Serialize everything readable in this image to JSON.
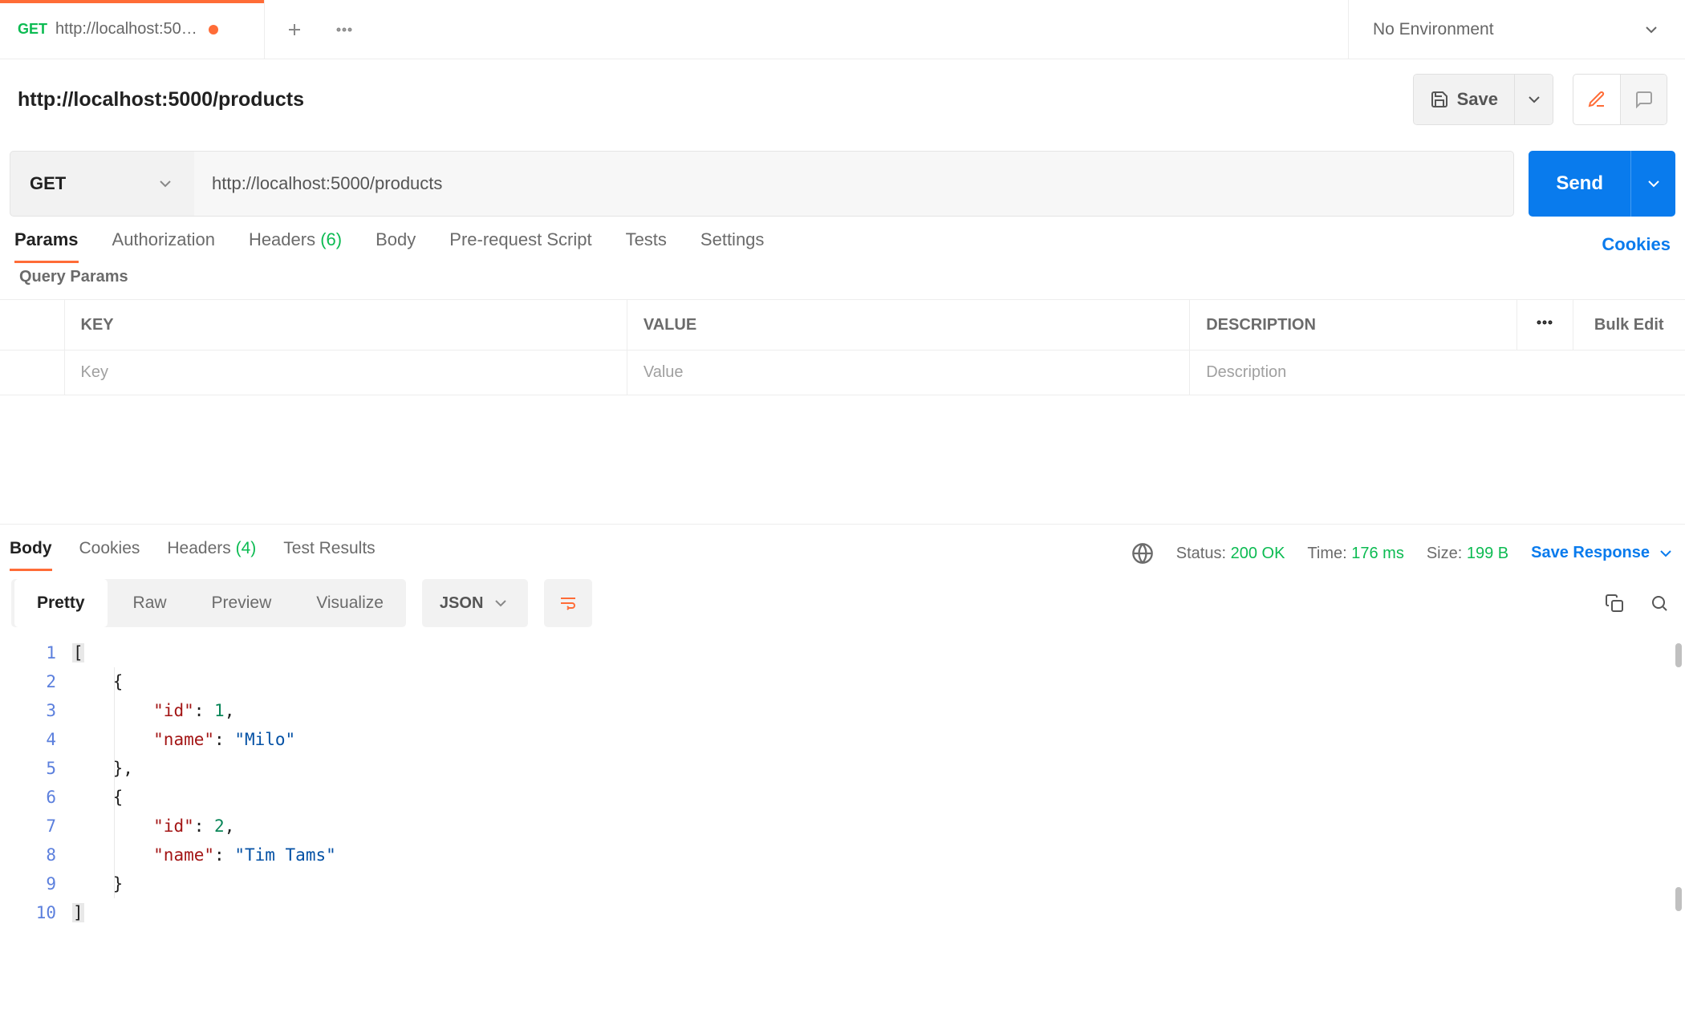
{
  "colors": {
    "accent": "#ff6c37",
    "primary": "#097bed",
    "success": "#0cbb52"
  },
  "tab": {
    "method": "GET",
    "title": "http://localhost:50…",
    "unsaved": true
  },
  "environment": {
    "selected": "No Environment"
  },
  "request": {
    "name": "http://localhost:5000/products",
    "method": "GET",
    "url": "http://localhost:5000/products",
    "save_label": "Save",
    "send_label": "Send",
    "tabs": {
      "params": "Params",
      "authorization": "Authorization",
      "headers": "Headers",
      "headers_count": "(6)",
      "body": "Body",
      "prerequest": "Pre-request Script",
      "tests": "Tests",
      "settings": "Settings",
      "cookies": "Cookies"
    },
    "query_params_label": "Query Params",
    "params_table": {
      "headers": {
        "key": "KEY",
        "value": "VALUE",
        "description": "DESCRIPTION",
        "bulk": "Bulk Edit"
      },
      "placeholders": {
        "key": "Key",
        "value": "Value",
        "description": "Description"
      }
    }
  },
  "response": {
    "tabs": {
      "body": "Body",
      "cookies": "Cookies",
      "headers": "Headers",
      "headers_count": "(4)",
      "test_results": "Test Results"
    },
    "status_label": "Status:",
    "status_value": "200 OK",
    "time_label": "Time:",
    "time_value": "176 ms",
    "size_label": "Size:",
    "size_value": "199 B",
    "save_response": "Save Response",
    "view_modes": {
      "pretty": "Pretty",
      "raw": "Raw",
      "preview": "Preview",
      "visualize": "Visualize"
    },
    "format": "JSON",
    "body_data": [
      {
        "id": 1,
        "name": "Milo"
      },
      {
        "id": 2,
        "name": "Tim Tams"
      }
    ],
    "body_lines": {
      "l1": "[",
      "l2": "    {",
      "l3_k": "\"id\"",
      "l3_sep": ": ",
      "l3_v": "1",
      "l3_end": ",",
      "l4_k": "\"name\"",
      "l4_sep": ": ",
      "l4_v": "\"Milo\"",
      "l5": "    },",
      "l6": "    {",
      "l7_k": "\"id\"",
      "l7_sep": ": ",
      "l7_v": "2",
      "l7_end": ",",
      "l8_k": "\"name\"",
      "l8_sep": ": ",
      "l8_v": "\"Tim Tams\"",
      "l9": "    }",
      "l10": "]"
    },
    "line_numbers": [
      "1",
      "2",
      "3",
      "4",
      "5",
      "6",
      "7",
      "8",
      "9",
      "10"
    ]
  }
}
